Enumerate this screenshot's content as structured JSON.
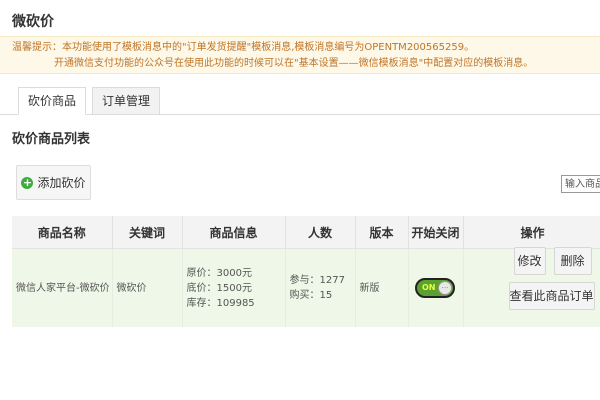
{
  "page": {
    "title": "微砍价"
  },
  "notice": {
    "line1": "温馨提示：本功能使用了模板消息中的\"订单发货提醒\"模板消息,模板消息编号为OPENTM200565259。",
    "line2": "开通微信支付功能的公众号在使用此功能的时候可以在\"基本设置——微信模板消息\"中配置对应的模板消息。"
  },
  "tabs": [
    {
      "label": "砍价商品",
      "active": true
    },
    {
      "label": "订单管理",
      "active": false
    }
  ],
  "section": {
    "title": "砍价商品列表"
  },
  "toolbar": {
    "add_label": "添加砍价",
    "add_icon": "plus-circle-icon"
  },
  "search": {
    "placeholder": "输入商品"
  },
  "table": {
    "headers": [
      "商品名称",
      "关键词",
      "商品信息",
      "人数",
      "版本",
      "开始关闭",
      "操作"
    ],
    "rows": [
      {
        "name": "微信人家平台-微砍价",
        "keyword": "微砍价",
        "info": [
          "原价：3000元",
          "底价：1500元",
          "库存：109985"
        ],
        "people": [
          "参与：1277",
          "购买：15"
        ],
        "version": "新版",
        "toggle": {
          "label": "ON",
          "on": true
        },
        "actions": {
          "edit": "修改",
          "delete": "删除",
          "view_orders": "查看此商品订单"
        }
      }
    ]
  },
  "colors": {
    "notice_text": "#c0752a",
    "notice_bg": "#fdf8e7",
    "row_bg": "#eff7e8",
    "toggle_on": "#5ba12f",
    "version_text": "#3a8a33"
  }
}
